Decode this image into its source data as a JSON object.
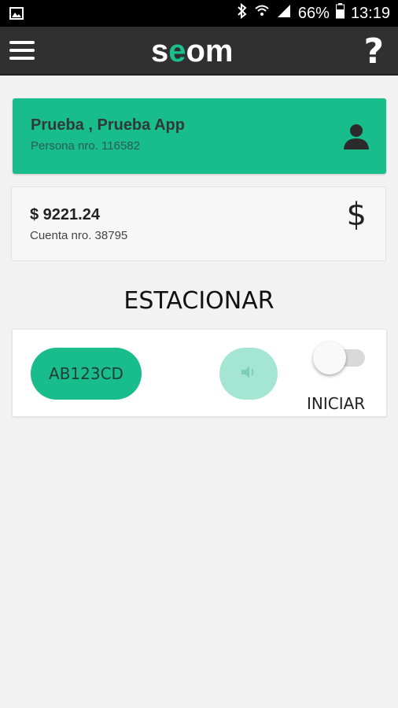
{
  "status_bar": {
    "battery_percent": "66%",
    "time": "13:19",
    "icons": [
      "gallery-icon",
      "bluetooth-icon",
      "wifi-icon",
      "signal-icon",
      "battery-icon"
    ]
  },
  "app_bar": {
    "logo_prefix": "s",
    "logo_accent": "e",
    "logo_suffix": "om",
    "help_label": "?",
    "menu_icon": "hamburger-menu-icon"
  },
  "person": {
    "name": "Prueba , Prueba App",
    "subtitle": "Persona nro. 116582",
    "icon": "user-icon"
  },
  "account": {
    "balance": "$ 9221.24",
    "subtitle": "Cuenta nro. 38795",
    "currency_symbol": "$"
  },
  "parking": {
    "title": "ESTACIONAR",
    "plate": "AB123CD",
    "sound_icon": "volume-icon",
    "toggle_state": "off",
    "start_label": "INICIAR"
  },
  "colors": {
    "accent": "#19bc8b",
    "accent_light": "#a5e6d2",
    "appbar": "#303030",
    "background": "#f2f2f2"
  }
}
